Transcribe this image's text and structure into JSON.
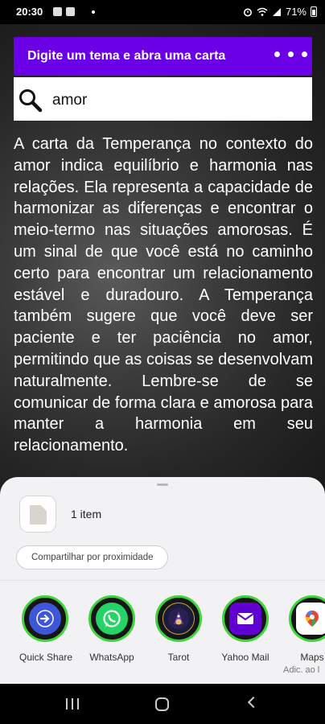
{
  "status_bar": {
    "time": "20:30",
    "battery": "71%"
  },
  "app_bar": {
    "title": "Digite um tema e abra uma carta"
  },
  "search": {
    "value": "amor"
  },
  "result_text": "A carta da Temperança no contexto do amor indica equilíbrio e harmonia nas relações. Ela representa a capacidade de harmonizar as diferenças e encontrar o meio-termo nas situações amorosas. É um sinal de que você está no caminho certo para encontrar um relacionamento estável e duradouro. A Temperança também sugere que você deve ser paciente e ter paciência no amor, permitindo que as coisas se desenvolvam naturalmente. Lembre-se de se comunicar de forma clara e amorosa para manter a harmonia em seu relacionamento.",
  "share_sheet": {
    "item_count": "1 item",
    "nearby_label": "Compartilhar por proximidade",
    "apps": [
      {
        "label": "Quick Share",
        "icon": "quick-share-icon"
      },
      {
        "label": "WhatsApp",
        "icon": "whatsapp-icon"
      },
      {
        "label": "Tarot",
        "icon": "tarot-icon"
      },
      {
        "label": "Yahoo Mail",
        "icon": "yahoo-mail-icon"
      },
      {
        "label": "Maps",
        "sublabel": "Adic. ao l",
        "icon": "maps-icon"
      }
    ]
  },
  "colors": {
    "app_bar": "#6b00e6",
    "app_ring": "#3fd43c",
    "whatsapp": "#25d366",
    "yahoo": "#6001d2",
    "quick_share": "#3e56d8"
  }
}
